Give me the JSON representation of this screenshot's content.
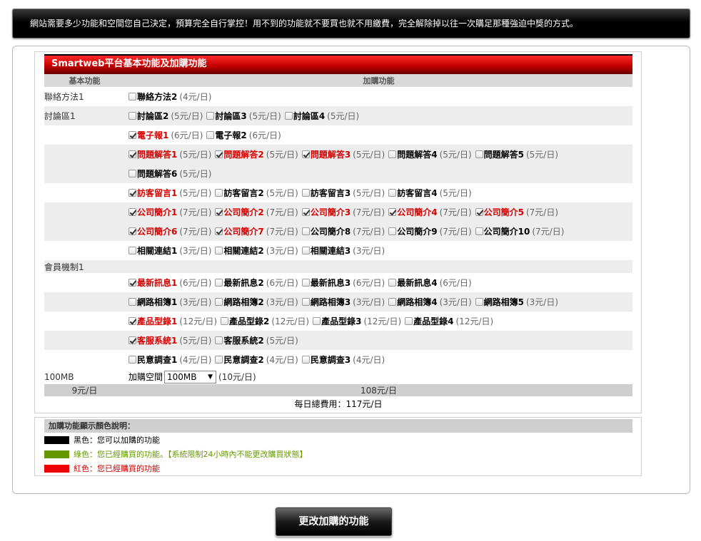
{
  "notice": "網站需要多少功能和空間您自己決定，預算完全自行掌控！用不到的功能就不要買也就不用繳費，完全解除掉以往一次購足那種強迫中獎的方式。",
  "panel_title": "Smartweb平台基本功能及加購功能",
  "headers": {
    "base": "基本功能",
    "addon": "加購功能"
  },
  "rows": [
    {
      "base": "聯絡方法1",
      "alt": false,
      "lines": [
        [
          {
            "name": "聯絡方法2",
            "price": "(4元/日)",
            "checked": false
          }
        ]
      ]
    },
    {
      "base": "討論區1",
      "alt": true,
      "lines": [
        [
          {
            "name": "討論區2",
            "price": "(5元/日)",
            "checked": false
          },
          {
            "name": "討論區3",
            "price": "(5元/日)",
            "checked": false
          },
          {
            "name": "討論區4",
            "price": "(5元/日)",
            "checked": false
          }
        ]
      ]
    },
    {
      "base": "",
      "alt": false,
      "lines": [
        [
          {
            "name": "電子報1",
            "price": "(6元/日)",
            "checked": true
          },
          {
            "name": "電子報2",
            "price": "(6元/日)",
            "checked": false
          }
        ]
      ]
    },
    {
      "base": "",
      "alt": true,
      "lines": [
        [
          {
            "name": "問題解答1",
            "price": "(5元/日)",
            "checked": true
          },
          {
            "name": "問題解答2",
            "price": "(5元/日)",
            "checked": true
          },
          {
            "name": "問題解答3",
            "price": "(5元/日)",
            "checked": true
          },
          {
            "name": "問題解答4",
            "price": "(5元/日)",
            "checked": false
          },
          {
            "name": "問題解答5",
            "price": "(5元/日)",
            "checked": false
          }
        ],
        [
          {
            "name": "問題解答6",
            "price": "(5元/日)",
            "checked": false
          }
        ]
      ]
    },
    {
      "base": "",
      "alt": false,
      "lines": [
        [
          {
            "name": "訪客留言1",
            "price": "(5元/日)",
            "checked": true
          },
          {
            "name": "訪客留言2",
            "price": "(5元/日)",
            "checked": false
          },
          {
            "name": "訪客留言3",
            "price": "(5元/日)",
            "checked": false
          },
          {
            "name": "訪客留言4",
            "price": "(5元/日)",
            "checked": false
          }
        ]
      ]
    },
    {
      "base": "",
      "alt": true,
      "lines": [
        [
          {
            "name": "公司簡介1",
            "price": "(7元/日)",
            "checked": true
          },
          {
            "name": "公司簡介2",
            "price": "(7元/日)",
            "checked": true
          },
          {
            "name": "公司簡介3",
            "price": "(7元/日)",
            "checked": true
          },
          {
            "name": "公司簡介4",
            "price": "(7元/日)",
            "checked": true
          },
          {
            "name": "公司簡介5",
            "price": "(7元/日)",
            "checked": true
          }
        ],
        [
          {
            "name": "公司簡介6",
            "price": "(7元/日)",
            "checked": true
          },
          {
            "name": "公司簡介7",
            "price": "(7元/日)",
            "checked": true
          },
          {
            "name": "公司簡介8",
            "price": "(7元/日)",
            "checked": false
          },
          {
            "name": "公司簡介9",
            "price": "(7元/日)",
            "checked": false
          },
          {
            "name": "公司簡介10",
            "price": "(7元/日)",
            "checked": false
          }
        ]
      ]
    },
    {
      "base": "",
      "alt": false,
      "lines": [
        [
          {
            "name": "相關連結1",
            "price": "(3元/日)",
            "checked": false
          },
          {
            "name": "相關連結2",
            "price": "(3元/日)",
            "checked": false
          },
          {
            "name": "相關連結3",
            "price": "(3元/日)",
            "checked": false
          }
        ]
      ]
    },
    {
      "base": "會員機制1",
      "alt": true,
      "short": true,
      "lines": []
    },
    {
      "base": "",
      "alt": false,
      "lines": [
        [
          {
            "name": "最新訊息1",
            "price": "(6元/日)",
            "checked": true
          },
          {
            "name": "最新訊息2",
            "price": "(6元/日)",
            "checked": false
          },
          {
            "name": "最新訊息3",
            "price": "(6元/日)",
            "checked": false
          },
          {
            "name": "最新訊息4",
            "price": "(6元/日)",
            "checked": false
          }
        ]
      ]
    },
    {
      "base": "",
      "alt": true,
      "lines": [
        [
          {
            "name": "網路相簿1",
            "price": "(3元/日)",
            "checked": false
          },
          {
            "name": "網路相簿2",
            "price": "(3元/日)",
            "checked": false
          },
          {
            "name": "網路相簿3",
            "price": "(3元/日)",
            "checked": false
          },
          {
            "name": "網路相簿4",
            "price": "(3元/日)",
            "checked": false
          },
          {
            "name": "網路相簿5",
            "price": "(3元/日)",
            "checked": false
          }
        ]
      ]
    },
    {
      "base": "",
      "alt": false,
      "lines": [
        [
          {
            "name": "產品型錄1",
            "price": "(12元/日)",
            "checked": true
          },
          {
            "name": "產品型錄2",
            "price": "(12元/日)",
            "checked": false
          },
          {
            "name": "產品型錄3",
            "price": "(12元/日)",
            "checked": false
          },
          {
            "name": "產品型錄4",
            "price": "(12元/日)",
            "checked": false
          }
        ]
      ]
    },
    {
      "base": "",
      "alt": true,
      "lines": [
        [
          {
            "name": "客服系統1",
            "price": "(5元/日)",
            "checked": true
          },
          {
            "name": "客服系統2",
            "price": "(5元/日)",
            "checked": false
          }
        ]
      ]
    },
    {
      "base": "",
      "alt": false,
      "lines": [
        [
          {
            "name": "民意調查1",
            "price": "(4元/日)",
            "checked": false
          },
          {
            "name": "民意調查2",
            "price": "(4元/日)",
            "checked": false
          },
          {
            "name": "民意調查3",
            "price": "(4元/日)",
            "checked": false
          }
        ]
      ]
    }
  ],
  "space": {
    "base": "100MB",
    "label": "加購空間",
    "selected": "100MB",
    "price": "(10元/日)"
  },
  "sum": {
    "base": "9元/日",
    "addon": "108元/日"
  },
  "total": "每日總費用：117元/日",
  "legend": {
    "title": "加購功能顯示顏色說明：",
    "items": [
      {
        "color": "#000000",
        "text": "黑色：您可以加購的功能",
        "text_color": "#000000"
      },
      {
        "color": "#669900",
        "text": "綠色：您已經購買的功能。【系統限制24小時內不能更改購買狀態】",
        "text_color": "#669900"
      },
      {
        "color": "#ee0000",
        "text": "紅色：您已經購買的功能",
        "text_color": "#cc0000"
      }
    ]
  },
  "submit": "更改加購的功能"
}
